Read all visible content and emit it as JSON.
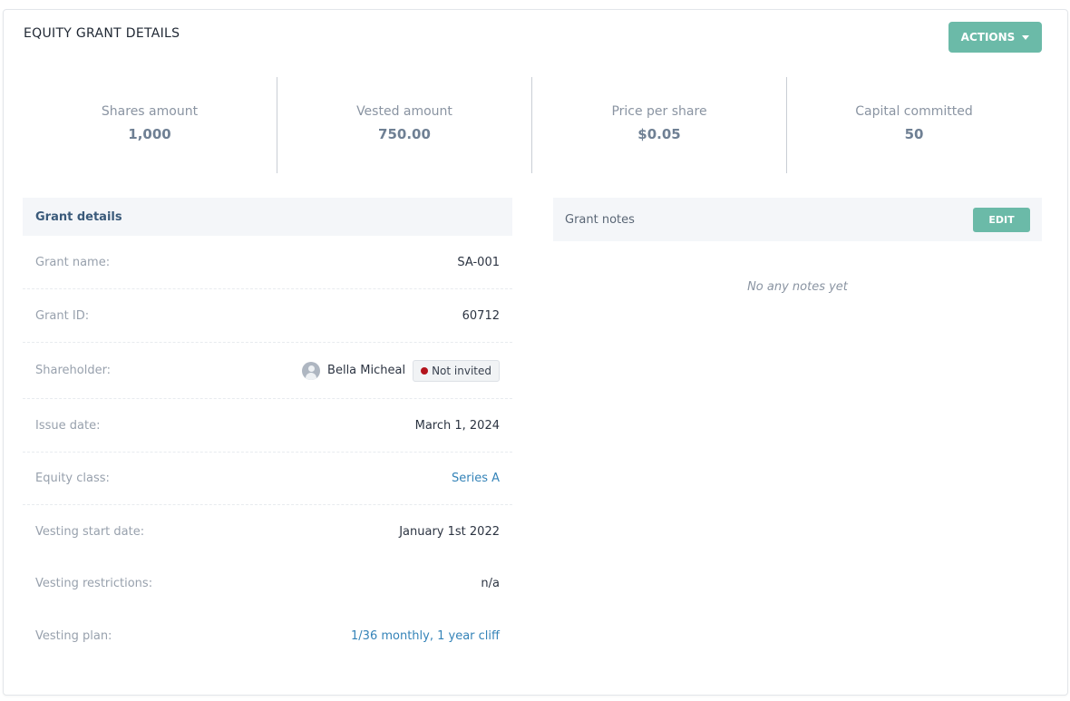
{
  "header": {
    "title": "EQUITY GRANT DETAILS",
    "actions_label": "ACTIONS"
  },
  "stats": [
    {
      "label": "Shares amount",
      "value": "1,000"
    },
    {
      "label": "Vested amount",
      "value": "750.00"
    },
    {
      "label": "Price per share",
      "value": "$0.05"
    },
    {
      "label": "Capital committed",
      "value": "50"
    }
  ],
  "grant_details": {
    "title": "Grant details",
    "rows": {
      "grant_name": {
        "label": "Grant name:",
        "value": "SA-001"
      },
      "grant_id": {
        "label": "Grant ID:",
        "value": "60712"
      },
      "shareholder": {
        "label": "Shareholder:",
        "value": "Bella Micheal",
        "status": "Not invited",
        "status_color": "#b3141c"
      },
      "issue_date": {
        "label": "Issue date:",
        "value": "March 1, 2024"
      },
      "equity_class": {
        "label": "Equity class:",
        "value": "Series A"
      },
      "vesting_start": {
        "label": "Vesting start date:",
        "value": "January 1st 2022"
      },
      "vesting_restrictions": {
        "label": "Vesting restrictions:",
        "value": "n/a"
      },
      "vesting_plan": {
        "label": "Vesting plan:",
        "value": "1/36 monthly, 1 year cliff"
      }
    }
  },
  "grant_notes": {
    "title": "Grant notes",
    "edit_label": "EDIT",
    "empty_text": "No any notes yet"
  },
  "colors": {
    "accent": "#6bbaa8",
    "link": "#3483b8"
  }
}
